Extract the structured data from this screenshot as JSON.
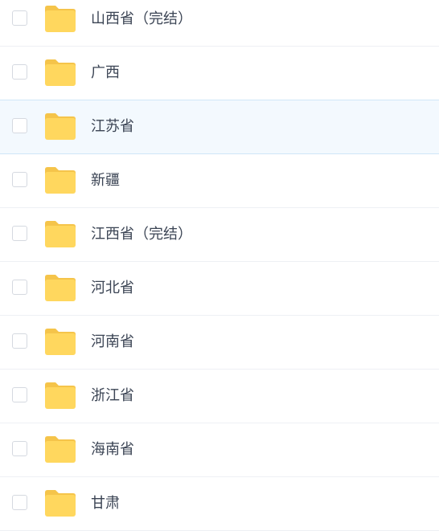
{
  "icons": {
    "checkbox": "checkbox-unchecked",
    "folder": "folder-icon"
  },
  "colors": {
    "folder_body": "#FFD75E",
    "folder_tab": "#F5C44A",
    "hover_bg": "#f3f9fe",
    "text": "#3b4454"
  },
  "files": [
    {
      "name": "山西省（完结）"
    },
    {
      "name": "广西"
    },
    {
      "name": "江苏省",
      "hovered": true
    },
    {
      "name": "新疆"
    },
    {
      "name": "江西省（完结）"
    },
    {
      "name": "河北省"
    },
    {
      "name": "河南省"
    },
    {
      "name": "浙江省"
    },
    {
      "name": "海南省"
    },
    {
      "name": "甘肃"
    }
  ]
}
